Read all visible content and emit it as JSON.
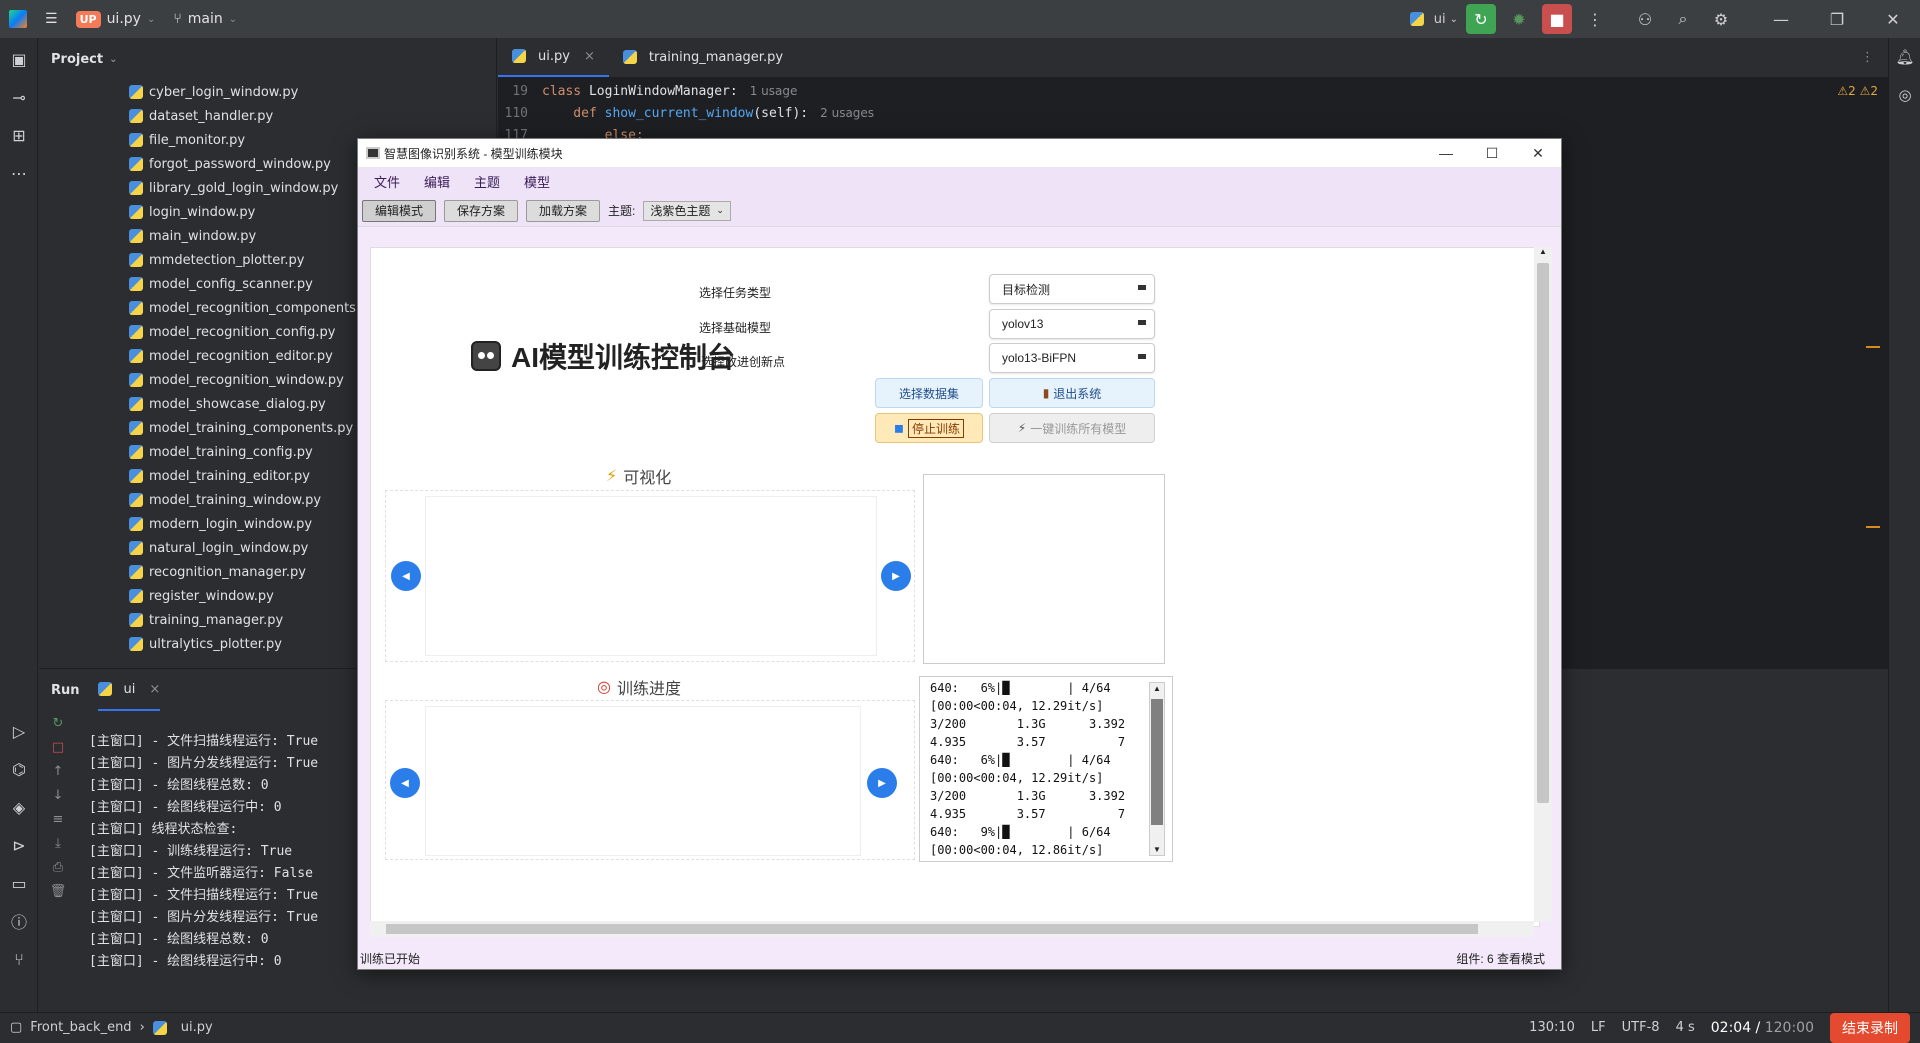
{
  "ide": {
    "project_badge": "UP",
    "file_name": "ui.py",
    "branch": "main",
    "run_config": "ui",
    "project_label": "Project",
    "files": [
      "cyber_login_window.py",
      "dataset_handler.py",
      "file_monitor.py",
      "forgot_password_window.py",
      "library_gold_login_window.py",
      "login_window.py",
      "main_window.py",
      "mmdetection_plotter.py",
      "model_config_scanner.py",
      "model_recognition_components.py",
      "model_recognition_config.py",
      "model_recognition_editor.py",
      "model_recognition_window.py",
      "model_showcase_dialog.py",
      "model_training_components.py",
      "model_training_config.py",
      "model_training_editor.py",
      "model_training_window.py",
      "modern_login_window.py",
      "natural_login_window.py",
      "recognition_manager.py",
      "register_window.py",
      "training_manager.py",
      "ultralytics_plotter.py"
    ],
    "tabs": [
      "ui.py",
      "training_manager.py"
    ],
    "code": [
      {
        "ln": "19",
        "pre": "class ",
        "name": "LoginWindowManager",
        "post": ":",
        "usage": "1 usage"
      },
      {
        "ln": "110",
        "pre": "    def ",
        "name": "show_current_window",
        "post": "(self):",
        "usage": "2 usages"
      },
      {
        "ln": "117",
        "pre": "        else:",
        "name": "",
        "post": "",
        "usage": ""
      }
    ],
    "inspections": "⚠2  ⚠2",
    "run_label": "Run",
    "run_tab": "ui",
    "console": [
      "[主窗口] - 文件扫描线程运行: True",
      "[主窗口] - 图片分发线程运行: True",
      "[主窗口] - 绘图线程总数: 0",
      "[主窗口] - 绘图线程运行中: 0",
      "[主窗口] 线程状态检查:",
      "[主窗口] - 训练线程运行: True",
      "[主窗口] - 文件监听器运行: False",
      "[主窗口] - 文件扫描线程运行: True",
      "[主窗口] - 图片分发线程运行: True",
      "[主窗口] - 绘图线程总数: 0",
      "[主窗口] - 绘图线程运行中: 0"
    ],
    "status": {
      "project": "Front_back_end",
      "file": "ui.py",
      "position": "130:10",
      "eol": "LF",
      "encoding": "UTF-8",
      "indent": "4 s"
    },
    "timer": {
      "elapsed": "02:04",
      "total": "120:00"
    },
    "end_record": "结束录制"
  },
  "app": {
    "window_title": "智慧图像识别系统 - 模型训练模块",
    "menus": [
      "文件",
      "编辑",
      "主题",
      "模型"
    ],
    "toolbar": {
      "edit_mode": "编辑模式",
      "save_plan": "保存方案",
      "load_plan": "加载方案",
      "theme_label": "主题:",
      "theme_value": "浅紫色主题"
    },
    "title": "AI模型训练控制台",
    "form": {
      "task_label": "选择任务类型",
      "task_value": "目标检测",
      "model_label": "选择基础模型",
      "model_value": "yolov13",
      "improve_label": "选择改进创新点",
      "improve_value": "yolo13-BiFPN"
    },
    "buttons": {
      "select_dataset": "选择数据集",
      "exit": "退出系统",
      "stop_training": "停止训练",
      "train_all": "一键训练所有模型"
    },
    "visual_header": "可视化",
    "progress_header": "训练进度",
    "log_lines": [
      "640:   6%|█        | 4/64",
      "[00:00<00:04, 12.29it/s]",
      "3/200       1.3G      3.392",
      "4.935       3.57          7",
      "640:   6%|█        | 4/64",
      "[00:00<00:04, 12.29it/s]",
      "3/200       1.3G      3.392",
      "4.935       3.57          7",
      "640:   9%|█        | 6/64",
      "[00:00<00:04, 12.86it/s]"
    ],
    "status_left": "训练已开始",
    "status_right": "组件: 6 查看模式"
  },
  "colors": {
    "accent": "#2b7de9",
    "window_bg": "#f3e9fa",
    "ide_bg": "#2b2d30",
    "end_record": "#e34a2f"
  }
}
